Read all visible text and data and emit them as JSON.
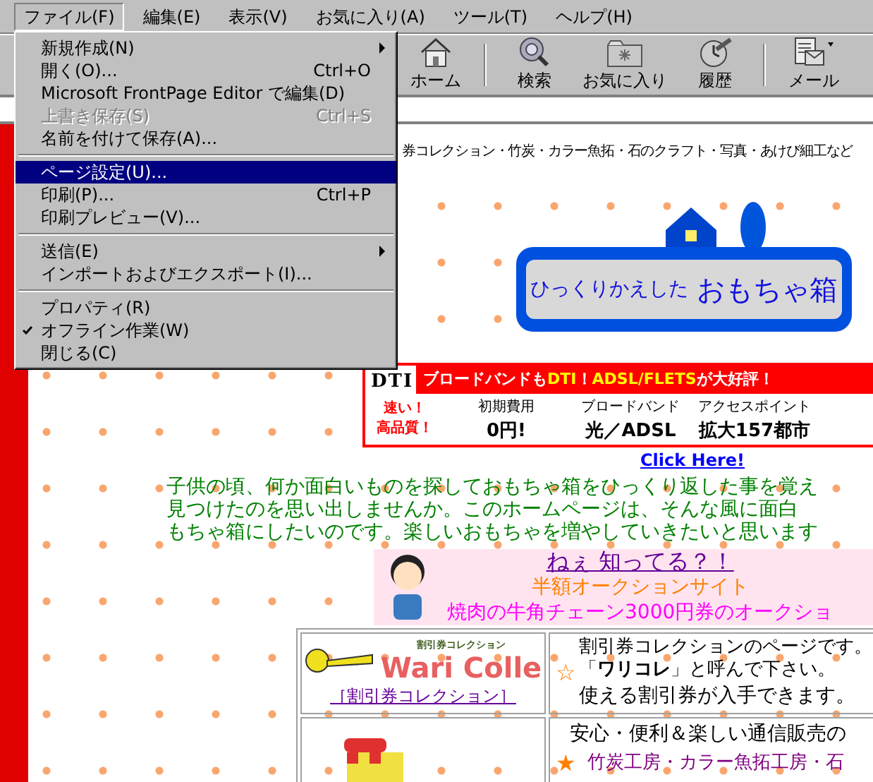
{
  "menu_bar": [
    {
      "label": "ファイル(F)",
      "selected": true
    },
    {
      "label": "編集(E)",
      "selected": false
    },
    {
      "label": "表示(V)",
      "selected": false
    },
    {
      "label": "お気に入り(A)",
      "selected": false
    },
    {
      "label": "ツール(T)",
      "selected": false
    },
    {
      "label": "ヘルプ(H)",
      "selected": false
    }
  ],
  "file_menu": [
    {
      "kind": "item",
      "label": "新規作成(N)",
      "submenu": true,
      "disabled": false,
      "selected": false,
      "checked": false
    },
    {
      "kind": "item",
      "label": "開く(O)...",
      "shortcut": "Ctrl+O",
      "submenu": false,
      "disabled": false,
      "selected": false,
      "checked": false
    },
    {
      "kind": "item",
      "label": "Microsoft FrontPage Editor で編集(D)",
      "submenu": false,
      "disabled": false,
      "selected": false,
      "checked": false
    },
    {
      "kind": "item",
      "label": "上書き保存(S)",
      "shortcut": "Ctrl+S",
      "submenu": false,
      "disabled": true,
      "selected": false,
      "checked": false
    },
    {
      "kind": "item",
      "label": "名前を付けて保存(A)...",
      "submenu": false,
      "disabled": false,
      "selected": false,
      "checked": false
    },
    {
      "kind": "separator"
    },
    {
      "kind": "item",
      "label": "ページ設定(U)...",
      "submenu": false,
      "disabled": false,
      "selected": true,
      "checked": false
    },
    {
      "kind": "item",
      "label": "印刷(P)...",
      "shortcut": "Ctrl+P",
      "submenu": false,
      "disabled": false,
      "selected": false,
      "checked": false
    },
    {
      "kind": "item",
      "label": "印刷プレビュー(V)...",
      "submenu": false,
      "disabled": false,
      "selected": false,
      "checked": false
    },
    {
      "kind": "separator"
    },
    {
      "kind": "item",
      "label": "送信(E)",
      "submenu": true,
      "disabled": false,
      "selected": false,
      "checked": false
    },
    {
      "kind": "item",
      "label": "インポートおよびエクスポート(I)...",
      "submenu": false,
      "disabled": false,
      "selected": false,
      "checked": false
    },
    {
      "kind": "separator"
    },
    {
      "kind": "item",
      "label": "プロパティ(R)",
      "submenu": false,
      "disabled": false,
      "selected": false,
      "checked": false
    },
    {
      "kind": "item",
      "label": "オフライン作業(W)",
      "submenu": false,
      "disabled": false,
      "selected": false,
      "checked": true
    },
    {
      "kind": "item",
      "label": "閉じる(C)",
      "submenu": false,
      "disabled": false,
      "selected": false,
      "checked": false
    }
  ],
  "toolbar": [
    {
      "kind": "home",
      "label": "ホーム"
    },
    {
      "kind": "separator"
    },
    {
      "kind": "search",
      "label": "検索"
    },
    {
      "kind": "favorites",
      "label": "お気に入り"
    },
    {
      "kind": "history",
      "label": "履歴"
    },
    {
      "kind": "separator"
    },
    {
      "kind": "mail",
      "label": "メール"
    }
  ],
  "page": {
    "tagline": "券コレクション・竹炭・カラー魚拓・石のクラフト・写真・あけび細工など",
    "logo": {
      "line_1": "ひっくりかえした",
      "line_2": "おもちゃ箱"
    },
    "banner": {
      "brand": "DTI",
      "headline": [
        {
          "text": "ブロードバンドも",
          "highlight": false
        },
        {
          "text": "DTI",
          "highlight": true
        },
        {
          "text": "！",
          "highlight": false
        },
        {
          "text": "ADSL/FLETS",
          "highlight": true
        },
        {
          "text": "が大好評！",
          "highlight": false
        }
      ],
      "slogan": [
        "速い！",
        "高品質！"
      ],
      "columns": [
        {
          "label": "初期費用",
          "value": "0円!"
        },
        {
          "label": "ブロードバンド",
          "value": "光／ADSL"
        },
        {
          "label": "アクセスポイント",
          "value": "拡大157都市"
        }
      ]
    },
    "click_link": "Click Here!",
    "intro": [
      "子供の頃、何か面白いものを探しておもちゃ箱をひっくり返した事を覚え",
      "見つけたのを思い出しませんか。このホームページは、そんな風に面白",
      "もちゃ箱にしたいのです。楽しいおもちゃを増やしていきたいと思います"
    ],
    "notice": {
      "title": "ねぇ 知ってる？！",
      "subtitle": "半額オークションサイト",
      "text": "焼肉の牛角チェーン3000円券のオークショ"
    },
    "table_rows": [
      {
        "kind": "coupon",
        "logo_small": "割引券コレクション",
        "logo_big": "Wari Colle",
        "link": "［割引券コレクション］",
        "star": "☆",
        "lines": [
          "割引券コレクションのページです。",
          "「**ワリコレ**」と呼んで下さい。",
          "使える割引券が入手できます。"
        ]
      },
      {
        "kind": "shop",
        "star": "★",
        "lines": [
          "安心・便利＆楽しい通信販売の",
          "竹炭工房・カラー魚拓工房・石"
        ]
      }
    ]
  }
}
